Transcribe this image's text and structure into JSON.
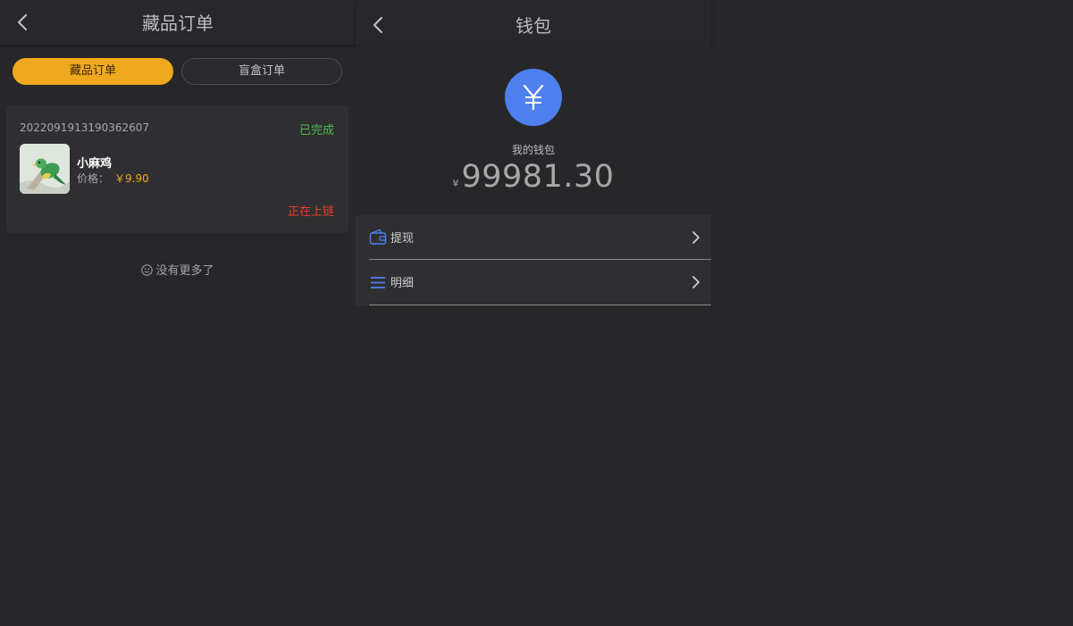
{
  "orders_screen": {
    "title": "藏品订单",
    "tabs": [
      {
        "label": "藏品订单",
        "active": true
      },
      {
        "label": "盲盒订单",
        "active": false
      }
    ],
    "order": {
      "number": "2022091913190362607",
      "status": "已完成",
      "item_name": "小麻鸡",
      "price_label": "价格：",
      "price": "￥9.90",
      "chain_status": "正在上链"
    },
    "end_text": "没有更多了"
  },
  "wallet_screen": {
    "title": "钱包",
    "wallet_label": "我的钱包",
    "currency": "¥",
    "balance": "99981.30",
    "menu": [
      {
        "label": "提现",
        "icon": "wallet-icon"
      },
      {
        "label": "明细",
        "icon": "list-icon"
      }
    ]
  },
  "colors": {
    "background": "#27272a",
    "accent": "#f0a91e",
    "success": "#4dbb4f",
    "danger": "#ef3b2d",
    "brand_blue": "#4f80f0"
  }
}
